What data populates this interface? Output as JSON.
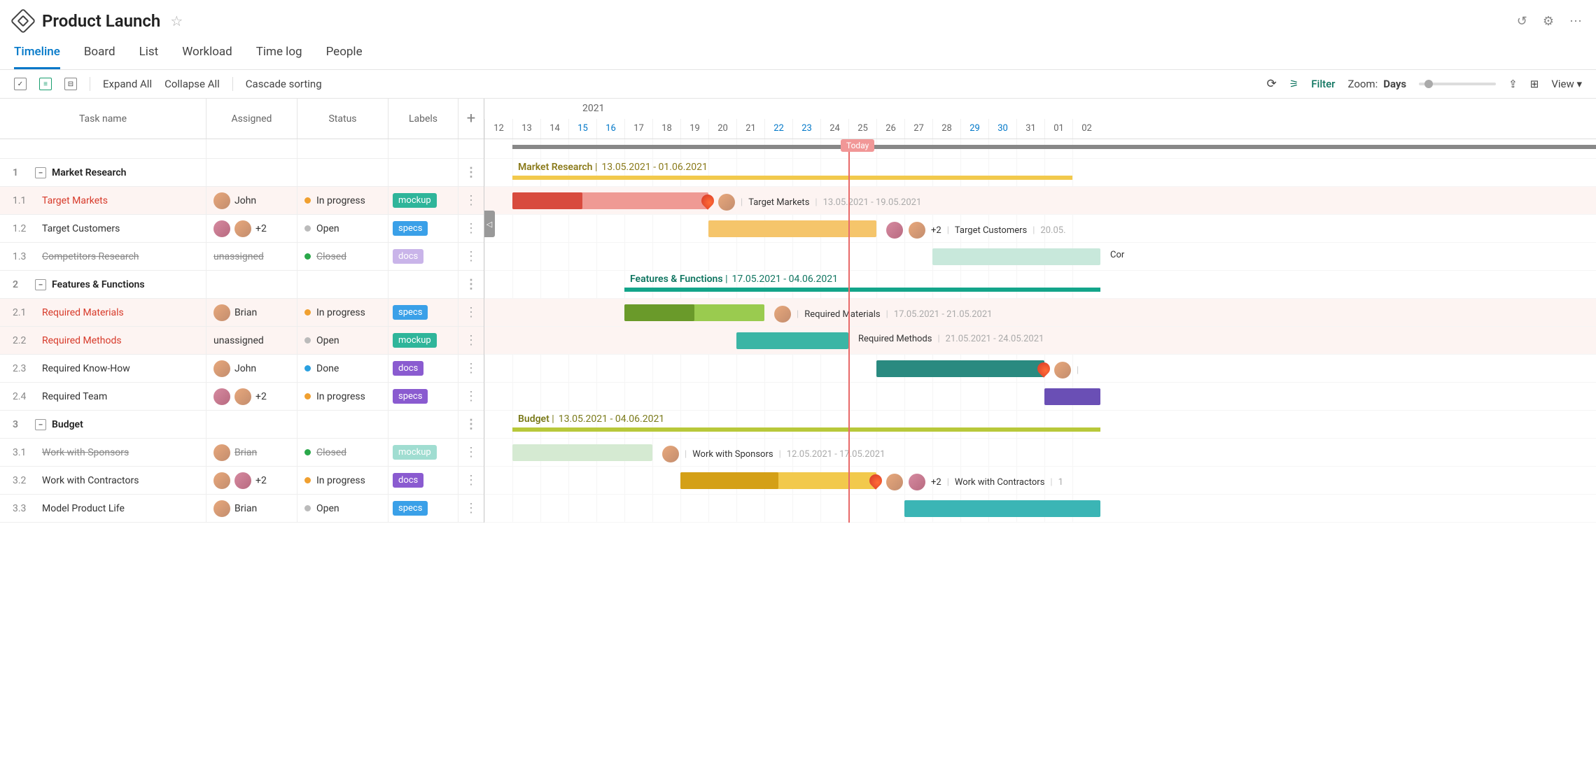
{
  "header": {
    "title": "Product Launch"
  },
  "tabs": [
    "Timeline",
    "Board",
    "List",
    "Workload",
    "Time log",
    "People"
  ],
  "toolbar": {
    "expand": "Expand All",
    "collapse": "Collapse All",
    "cascade": "Cascade sorting",
    "filter": "Filter",
    "zoom_label": "Zoom:",
    "zoom_value": "Days",
    "view": "View"
  },
  "columns": {
    "task": "Task name",
    "assigned": "Assigned",
    "status": "Status",
    "labels": "Labels"
  },
  "timeline": {
    "year": "2021",
    "days": [
      {
        "d": "12"
      },
      {
        "d": "13"
      },
      {
        "d": "14"
      },
      {
        "d": "15",
        "we": true
      },
      {
        "d": "16",
        "we": true
      },
      {
        "d": "17"
      },
      {
        "d": "18"
      },
      {
        "d": "19"
      },
      {
        "d": "20"
      },
      {
        "d": "21"
      },
      {
        "d": "22",
        "we": true
      },
      {
        "d": "23",
        "we": true
      },
      {
        "d": "24"
      },
      {
        "d": "25"
      },
      {
        "d": "26"
      },
      {
        "d": "27"
      },
      {
        "d": "28"
      },
      {
        "d": "29",
        "we": true
      },
      {
        "d": "30",
        "we": true
      },
      {
        "d": "31"
      },
      {
        "d": "01"
      },
      {
        "d": "02"
      }
    ],
    "today": "Today"
  },
  "status_colors": {
    "in_progress": "#f0a030",
    "open": "#bbb",
    "closed": "#2aa84a",
    "done": "#2aa0e0"
  },
  "label_colors": {
    "mockup": "#2fb59a",
    "specs": "#3aa0e8",
    "docs": "#8a5bd0"
  },
  "rows": [
    {
      "id": "1",
      "type": "group",
      "name": "Market Research",
      "gname": "Market Research",
      "gdates": "13.05.2021 - 01.06.2021",
      "gcolor": "#8a7a1a",
      "barcolor": "#f2c94c",
      "gx": 40,
      "gw": 800
    },
    {
      "id": "1.1",
      "type": "task",
      "name": "Target Markets",
      "assigned": "John",
      "av": [
        "m"
      ],
      "status": "In progress",
      "scolor": "#f0a030",
      "label": "mockup",
      "lcolor": "#2fb59a",
      "overdue": true,
      "bx": 40,
      "bw": 280,
      "bpw": 100,
      "bcolor": "#ef9a94",
      "pcolor": "#d84b3e",
      "fire": true,
      "txt_name": "Target Markets",
      "txt_dates": "13.05.2021 - 19.05.2021",
      "txtav": [
        "m"
      ]
    },
    {
      "id": "1.2",
      "type": "task",
      "name": "Target Customers",
      "av": [
        "f",
        "m"
      ],
      "extra": "+2",
      "status": "Open",
      "scolor": "#bbb",
      "label": "specs",
      "lcolor": "#3aa0e8",
      "bx": 320,
      "bw": 240,
      "bcolor": "#f5c56b",
      "txt_name": "Target Customers",
      "txt_dates": "20.05.",
      "txtav": [
        "f",
        "m"
      ],
      "txtextra": "+2"
    },
    {
      "id": "1.3",
      "type": "task",
      "name": "Competitors Research",
      "assigned": "unassigned",
      "status": "Closed",
      "scolor": "#2aa84a",
      "label": "docs",
      "lcolor": "#8a5bd0",
      "closed": true,
      "ghost": true,
      "bx": 640,
      "bw": 240,
      "bcolor": "#c8e8db",
      "txt_name": "Cor"
    },
    {
      "id": "2",
      "type": "group",
      "name": "Features & Functions",
      "gname": "Features & Functions",
      "gdates": "17.05.2021 - 04.06.2021",
      "gcolor": "#0f7560",
      "barcolor": "#13a58a",
      "gx": 200,
      "gw": 680
    },
    {
      "id": "2.1",
      "type": "task",
      "name": "Required Materials",
      "assigned": "Brian",
      "av": [
        "m"
      ],
      "status": "In progress",
      "scolor": "#f0a030",
      "label": "specs",
      "lcolor": "#3aa0e8",
      "overdue": true,
      "bx": 200,
      "bw": 200,
      "bpw": 100,
      "bcolor": "#9acb4f",
      "pcolor": "#6a9a2a",
      "txt_name": "Required Materials",
      "txt_dates": "17.05.2021 - 21.05.2021",
      "txtav": [
        "m"
      ]
    },
    {
      "id": "2.2",
      "type": "task",
      "name": "Required Methods",
      "assigned": "unassigned",
      "status": "Open",
      "scolor": "#bbb",
      "label": "mockup",
      "lcolor": "#2fb59a",
      "overdue": true,
      "bx": 360,
      "bw": 160,
      "bcolor": "#3bb5a5",
      "txt_name": "Required Methods",
      "txt_dates": "21.05.2021 - 24.05.2021"
    },
    {
      "id": "2.3",
      "type": "task",
      "name": "Required Know-How",
      "assigned": "John",
      "av": [
        "m"
      ],
      "status": "Done",
      "scolor": "#2aa0e0",
      "label": "docs",
      "lcolor": "#8a5bd0",
      "bx": 560,
      "bw": 240,
      "bcolor": "#2a8a80",
      "fire": true,
      "txtav": [
        "m"
      ]
    },
    {
      "id": "2.4",
      "type": "task",
      "name": "Required Team",
      "av": [
        "f",
        "m"
      ],
      "extra": "+2",
      "status": "In progress",
      "scolor": "#f0a030",
      "label": "specs",
      "lcolor": "#8a5bd0",
      "bx": 800,
      "bw": 80,
      "bcolor": "#6a4fb5"
    },
    {
      "id": "3",
      "type": "group",
      "name": "Budget",
      "gname": "Budget",
      "gdates": "13.05.2021 - 04.06.2021",
      "gcolor": "#7a7a1a",
      "barcolor": "#b8c83a",
      "gx": 40,
      "gw": 840
    },
    {
      "id": "3.1",
      "type": "task",
      "name": "Work with Sponsors",
      "assigned": "Brian",
      "av": [
        "m"
      ],
      "status": "Closed",
      "scolor": "#2aa84a",
      "label": "mockup",
      "lcolor": "#2fb59a",
      "closed": true,
      "ghost": true,
      "bx": 40,
      "bw": 200,
      "bcolor": "#d5ead2",
      "txt_name": "Work with Sponsors",
      "txt_dates": "12.05.2021 - 17.05.2021",
      "txtav": [
        "m"
      ]
    },
    {
      "id": "3.2",
      "type": "task",
      "name": "Work with Contractors",
      "av": [
        "m",
        "f"
      ],
      "extra": "+2",
      "status": "In progress",
      "scolor": "#f0a030",
      "label": "docs",
      "lcolor": "#8a5bd0",
      "bx": 280,
      "bw": 280,
      "bpw": 140,
      "bcolor": "#f2c94c",
      "pcolor": "#d4a017",
      "fire": true,
      "txt_name": "Work with Contractors",
      "txt_dates": "1",
      "txtav": [
        "m",
        "f"
      ],
      "txtextra": "+2"
    },
    {
      "id": "3.3",
      "type": "task",
      "name": "Model Product Life",
      "assigned": "Brian",
      "av": [
        "m"
      ],
      "status": "Open",
      "scolor": "#bbb",
      "label": "specs",
      "lcolor": "#3aa0e8",
      "bx": 600,
      "bw": 280,
      "bcolor": "#3bb5b5"
    }
  ]
}
